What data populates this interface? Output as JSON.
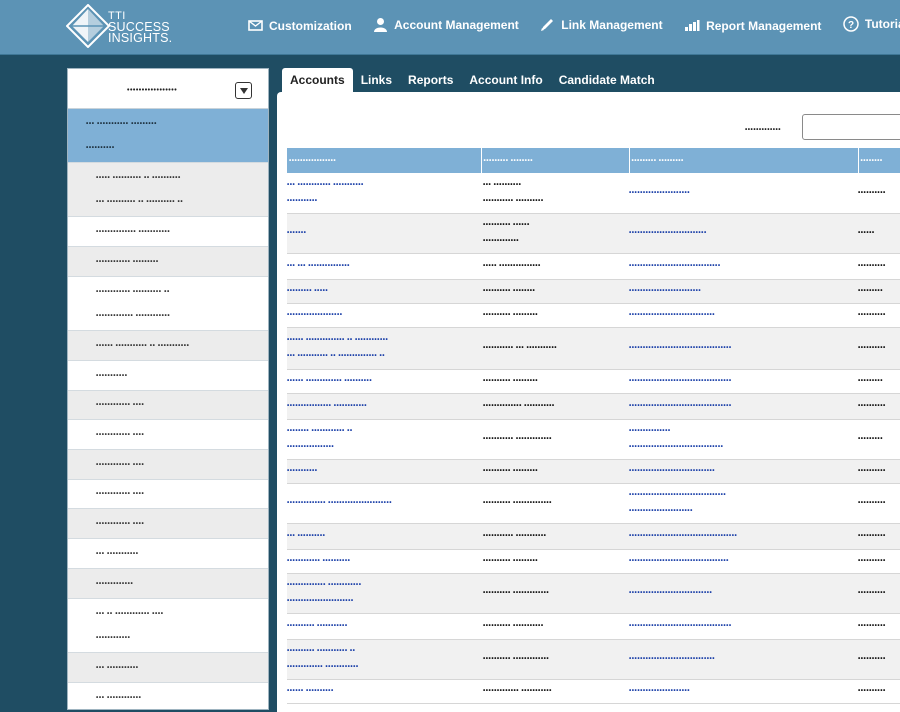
{
  "brand": {
    "line1": "TTI",
    "line2": "SUCCESS",
    "line3": "INSIGHTS."
  },
  "nav": [
    {
      "label": "Customization",
      "icon": "envelope-icon"
    },
    {
      "label": "Account Management",
      "icon": "user-icon"
    },
    {
      "label": "Link Management",
      "icon": "pencil-icon"
    },
    {
      "label": "Report Management",
      "icon": "bar-chart-icon"
    },
    {
      "label": "Tutorials",
      "icon": "help-icon"
    }
  ],
  "sidebar": {
    "title": "•••••••••••••••••",
    "items": [
      {
        "lines": [
          "••• ••••••••••• •••••••••",
          "••••••••••"
        ],
        "h": 54,
        "state": "selected"
      },
      {
        "lines": [
          "••••• •••••••••• •• ••••••••••",
          "••• •••••••••• •• •••••••••• ••"
        ],
        "h": 54,
        "state": "alt"
      },
      {
        "lines": [
          "•••••••••••••• •••••••••••"
        ],
        "h": 30,
        "state": ""
      },
      {
        "lines": [
          "•••••••••••• •••••••••"
        ],
        "h": 30,
        "state": "alt"
      },
      {
        "lines": [
          "•••••••••••• •••••••••• ••",
          "••••••••••••• ••••••••••••"
        ],
        "h": 54,
        "state": ""
      },
      {
        "lines": [
          "•••••• ••••••••••• •• •••••••••••"
        ],
        "h": 30,
        "state": "alt"
      },
      {
        "lines": [
          "•••••••••••"
        ],
        "h": 30,
        "state": ""
      },
      {
        "lines": [
          "•••••••••••• ••••"
        ],
        "h": 29,
        "state": "alt"
      },
      {
        "lines": [
          "•••••••••••• ••••"
        ],
        "h": 30,
        "state": ""
      },
      {
        "lines": [
          "•••••••••••• ••••"
        ],
        "h": 30,
        "state": "alt"
      },
      {
        "lines": [
          "•••••••••••• ••••"
        ],
        "h": 29,
        "state": ""
      },
      {
        "lines": [
          "•••••••••••• ••••"
        ],
        "h": 30,
        "state": "alt"
      },
      {
        "lines": [
          "••• •••••••••••"
        ],
        "h": 30,
        "state": ""
      },
      {
        "lines": [
          "•••••••••••••"
        ],
        "h": 30,
        "state": "alt"
      },
      {
        "lines": [
          "••• •• •••••••••••• ••••",
          "••••••••••••"
        ],
        "h": 54,
        "state": ""
      },
      {
        "lines": [
          "••• •••••••••••"
        ],
        "h": 30,
        "state": "alt"
      },
      {
        "lines": [
          "••• ••••••••••••"
        ],
        "h": 30,
        "state": ""
      }
    ]
  },
  "tabs": [
    {
      "label": "Accounts",
      "active": true
    },
    {
      "label": "Links",
      "active": false
    },
    {
      "label": "Reports",
      "active": false
    },
    {
      "label": "Account Info",
      "active": false
    },
    {
      "label": "Candidate Match",
      "active": false
    }
  ],
  "search": {
    "label": "•••••••••••••",
    "placeholder": ""
  },
  "table": {
    "headers": [
      "•••••••••••••••••",
      "••••••••• ••••••••",
      "••••••••• •••••••••",
      "••••••••"
    ],
    "rows": [
      {
        "c1": [
          "••• •••••••••••• •••••••••••",
          "•••••••••••"
        ],
        "c2": [
          "••• ••••••••••",
          "••••••••••• ••••••••••"
        ],
        "c3": [
          "••••••••••••••••••••••"
        ],
        "c4": [
          "••••••••••"
        ],
        "h": 40
      },
      {
        "c1": [
          "•••••••"
        ],
        "c2": [
          "•••••••••• ••••••",
          "•••••••••••••"
        ],
        "c3": [
          "••••••••••••••••••••••••••••"
        ],
        "c4": [
          "••••••"
        ],
        "h": 40
      },
      {
        "c1": [
          "••• ••• •••••••••••••••"
        ],
        "c2": [
          "••••• •••••••••••••••"
        ],
        "c3": [
          "•••••••••••••••••••••••••••••••••"
        ],
        "c4": [
          "••••••••••"
        ],
        "h": 26
      },
      {
        "c1": [
          "••••••••• •••••"
        ],
        "c2": [
          "•••••••••• ••••••••"
        ],
        "c3": [
          "••••••••••••••••••••••••••"
        ],
        "c4": [
          "•••••••••"
        ],
        "h": 24
      },
      {
        "c1": [
          "••••••••••••••••••••"
        ],
        "c2": [
          "•••••••••• •••••••••"
        ],
        "c3": [
          "•••••••••••••••••••••••••••••••"
        ],
        "c4": [
          "••••••••••"
        ],
        "h": 24
      },
      {
        "c1": [
          "•••••• •••••••••••••• •• ••••••••••••",
          "••• ••••••••••• •• •••••••••••••• ••"
        ],
        "c2": [
          "••••••••••• ••• •••••••••••"
        ],
        "c3": [
          "•••••••••••••••••••••••••••••••••••••"
        ],
        "c4": [
          "••••••••••"
        ],
        "h": 42
      },
      {
        "c1": [
          "•••••• ••••••••••••• ••••••••••"
        ],
        "c2": [
          "•••••••••• •••••••••"
        ],
        "c3": [
          "•••••••••••••••••••••••••••••••••••••"
        ],
        "c4": [
          "•••••••••"
        ],
        "h": 24
      },
      {
        "c1": [
          "•••••••••••••••• ••••••••••••"
        ],
        "c2": [
          "•••••••••••••• •••••••••••"
        ],
        "c3": [
          "•••••••••••••••••••••••••••••••••••••"
        ],
        "c4": [
          "••••••••••"
        ],
        "h": 26
      },
      {
        "c1": [
          "•••••••• •••••••••••• ••",
          "•••••••••••••••••"
        ],
        "c2": [
          "••••••••••• •••••••••••••"
        ],
        "c3": [
          "•••••••••••••••",
          "••••••••••••••••••••••••••••••••••"
        ],
        "c4": [
          "•••••••••"
        ],
        "h": 40
      },
      {
        "c1": [
          "•••••••••••"
        ],
        "c2": [
          "•••••••••• •••••••••"
        ],
        "c3": [
          "•••••••••••••••••••••••••••••••"
        ],
        "c4": [
          "••••••••••"
        ],
        "h": 24
      },
      {
        "c1": [
          "•••••••••••••• •••••••••••••••••••••••"
        ],
        "c2": [
          "•••••••••• ••••••••••••••"
        ],
        "c3": [
          "•••••••••••••••••••••••••••••••••••",
          "•••••••••••••••••••••••"
        ],
        "c4": [
          "••••••••••"
        ],
        "h": 40
      },
      {
        "c1": [
          "••• ••••••••••"
        ],
        "c2": [
          "••••••••••• •••••••••••"
        ],
        "c3": [
          "•••••••••••••••••••••••••••••••••••••••"
        ],
        "c4": [
          "••••••••••"
        ],
        "h": 26
      },
      {
        "c1": [
          "•••••••••••• ••••••••••"
        ],
        "c2": [
          "•••••••••• •••••••••"
        ],
        "c3": [
          "••••••••••••••••••••••••••••••••••••"
        ],
        "c4": [
          "••••••••••"
        ],
        "h": 24
      },
      {
        "c1": [
          "•••••••••••••• ••••••••••••",
          "••••••••••••••••••••••••"
        ],
        "c2": [
          "•••••••••• •••••••••••••"
        ],
        "c3": [
          "••••••••••••••••••••••••••••••"
        ],
        "c4": [
          "••••••••••"
        ],
        "h": 40
      },
      {
        "c1": [
          "•••••••••• •••••••••••"
        ],
        "c2": [
          "•••••••••• •••••••••••"
        ],
        "c3": [
          "•••••••••••••••••••••••••••••••••••••"
        ],
        "c4": [
          "••••••••••"
        ],
        "h": 26
      },
      {
        "c1": [
          "•••••••••• ••••••••••• ••",
          "••••••••••••• ••••••••••••"
        ],
        "c2": [
          "•••••••••• •••••••••••••"
        ],
        "c3": [
          "•••••••••••••••••••••••••••••••"
        ],
        "c4": [
          "••••••••••"
        ],
        "h": 40
      },
      {
        "c1": [
          "•••••• ••••••••••"
        ],
        "c2": [
          "••••••••••••• •••••••••••"
        ],
        "c3": [
          "••••••••••••••••••••••"
        ],
        "c4": [
          "••••••••••"
        ],
        "h": 24
      }
    ]
  }
}
